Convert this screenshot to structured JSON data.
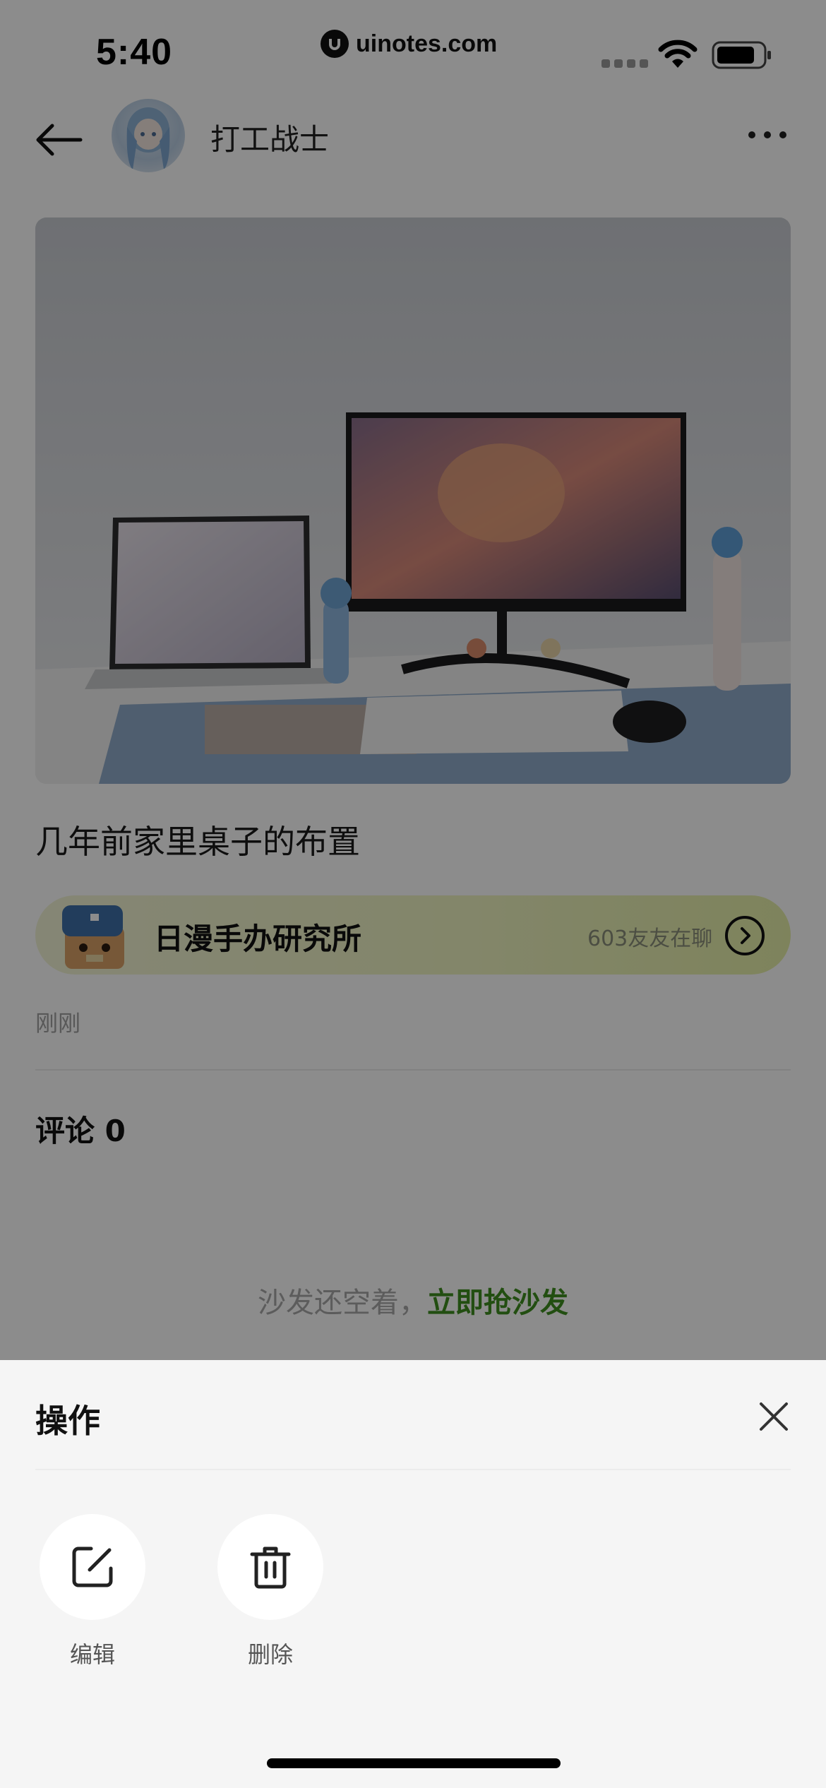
{
  "status_bar": {
    "time": "5:40",
    "watermark": "uinotes.com"
  },
  "post": {
    "author": "打工战士",
    "caption": "几年前家里桌子的布置",
    "time": "刚刚",
    "group": {
      "name": "日漫手办研究所",
      "online": "603友友在聊"
    },
    "comments_label": "评论 0",
    "empty_text": "沙发还空着，",
    "empty_cta": "立即抢沙发"
  },
  "action_sheet": {
    "title": "操作",
    "actions": [
      {
        "label": "编辑",
        "icon": "edit-icon"
      },
      {
        "label": "删除",
        "icon": "trash-icon"
      }
    ]
  },
  "colors": {
    "accent_green": "#3f8f1f",
    "banner_bg": "#eef4c0",
    "sheet_bg": "#f5f5f5"
  }
}
